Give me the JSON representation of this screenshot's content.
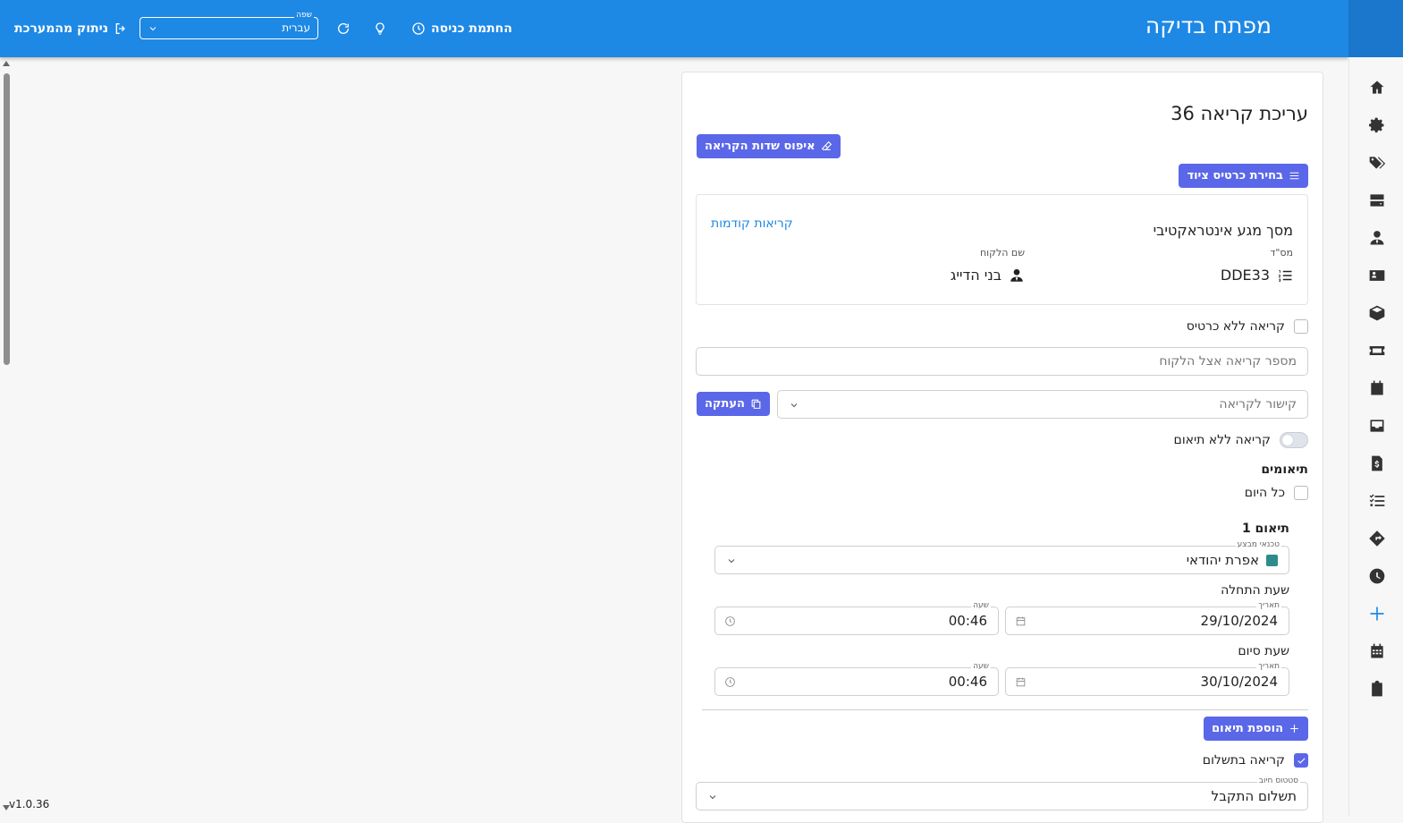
{
  "header": {
    "app_title": "מפתח בדיקה",
    "logout_label": "ניתוק מהמערכת",
    "language_label": "שפה",
    "language_value": "עברית",
    "entry_stamp_label": "החתמת כניסה"
  },
  "version": "v1.0.36",
  "sidebar": {
    "icons": [
      "home-icon",
      "gear-icon",
      "tags-icon",
      "server-icon",
      "user-tie-icon",
      "id-card-icon",
      "box-icon",
      "ticket-icon",
      "calendar-check-icon",
      "inbox-icon",
      "invoice-dollar-icon",
      "list-check-icon",
      "directions-icon",
      "clock-icon",
      "plus-icon",
      "calendar-icon",
      "clipboard-check-icon"
    ]
  },
  "form": {
    "title": "עריכת קריאה 36",
    "reset_button": "איפוס שדות הקריאה",
    "select_equipment_button": "בחירת כרטיס ציוד",
    "equipment": {
      "name": "מסך מגע אינטראקטיבי",
      "previous_calls_link": "קריאות קודמות",
      "serial_label": "מס\"ד",
      "serial_value": "DDE33",
      "customer_label": "שם הלקוח",
      "customer_value": "בני הדייג"
    },
    "no_card_label": "קריאה ללא כרטיס",
    "customer_call_number_placeholder": "מספר קריאה אצל הלקוח",
    "call_link_placeholder": "קישור לקריאה",
    "copy_button": "העתקה",
    "no_schedule_label": "קריאה ללא תיאום",
    "schedules_heading": "תיאומים",
    "all_day_label": "כל היום",
    "schedule": {
      "heading": "תיאום 1",
      "technician_label": "טכנאי מבצע",
      "technician_value": "אפרת יהודאי",
      "technician_color": "#2e8b8b",
      "start_heading": "שעת התחלה",
      "end_heading": "שעת סיום",
      "date_label": "תאריך",
      "time_label": "שעה",
      "start_date": "29/10/2024",
      "start_time": "00:46",
      "end_date": "30/10/2024",
      "end_time": "00:46"
    },
    "add_schedule_button": "הוספת תיאום",
    "paid_call_label": "קריאה בתשלום",
    "billing_status_label": "סטטוס חיוב",
    "billing_status_value": "תשלום התקבל"
  },
  "colors": {
    "header_blue": "#1e88e5",
    "accent_purple": "#5a67e8",
    "link_blue": "#1e88e5"
  }
}
